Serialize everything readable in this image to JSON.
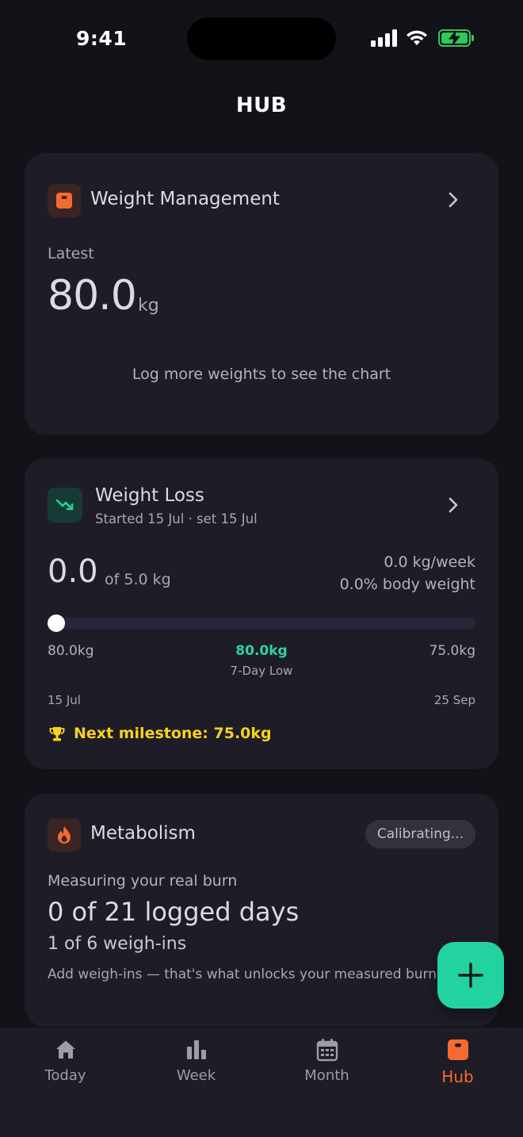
{
  "status_bar": {
    "time": "9:41"
  },
  "page": {
    "title": "HUB"
  },
  "weight_management": {
    "title": "Weight Management",
    "latest_label": "Latest",
    "latest_value": "80.0",
    "latest_unit": "kg",
    "chart_message": "Log more weights to see the chart"
  },
  "weight_loss": {
    "title": "Weight Loss",
    "subtitle": "Started 15 Jul · set 15 Jul",
    "lost_value": "0.0",
    "goal_text": "of 5.0 kg",
    "rate": "0.0 kg/week",
    "body_pct": "0.0% body weight",
    "progress_fraction": 0,
    "start_weight": "80.0kg",
    "low_value": "80.0kg",
    "low_label": "7-Day Low",
    "target_weight": "75.0kg",
    "start_date": "15 Jul",
    "end_date": "25 Sep",
    "milestone": "Next milestone: 75.0kg"
  },
  "metabolism": {
    "title": "Metabolism",
    "badge": "Calibrating...",
    "line1": "Measuring your real burn",
    "line2": "0 of 21 logged days",
    "line3": "1 of 6 weigh-ins",
    "line4": "Add weigh-ins — that's what unlocks your measured burn."
  },
  "tabs": [
    {
      "label": "Today",
      "icon": "home-icon"
    },
    {
      "label": "Week",
      "icon": "bar-chart-icon"
    },
    {
      "label": "Month",
      "icon": "calendar-icon"
    },
    {
      "label": "Hub",
      "icon": "scale-icon",
      "active": true
    }
  ],
  "colors": {
    "accent_orange": "#f56b2f",
    "accent_green": "#22d3a0",
    "milestone_yellow": "#f8d21c",
    "background": "#131219",
    "card": "#1e1d27"
  }
}
